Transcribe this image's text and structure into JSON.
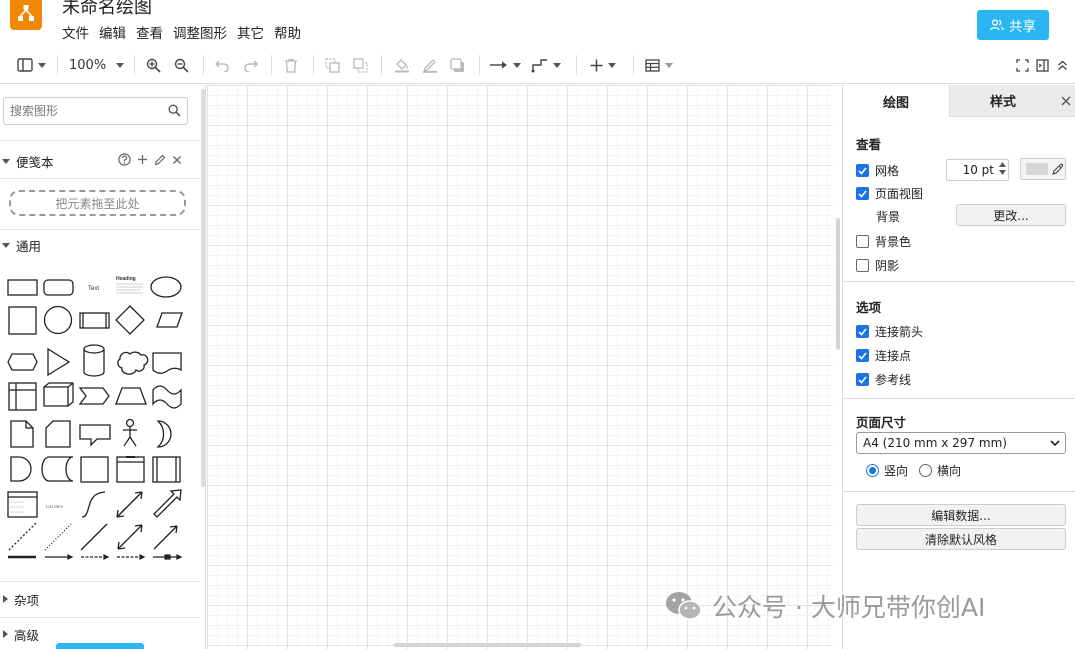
{
  "app": {
    "title": "未命名绘图",
    "brand_color": "#f08705",
    "accent_color": "#29b6f2",
    "logo_icon": "drawio-logo-icon"
  },
  "menu": [
    "文件",
    "编辑",
    "查看",
    "调整图形",
    "其它",
    "帮助"
  ],
  "share_button": {
    "label": "共享",
    "icon": "users-icon"
  },
  "toolbar": {
    "zoom": "100%",
    "icons": [
      "sidebar-toggle-icon",
      "zoom-in-icon",
      "zoom-out-icon",
      "undo-icon",
      "redo-icon",
      "delete-icon",
      "to-front-icon",
      "to-back-icon",
      "fill-color-icon",
      "line-color-icon",
      "shadow-icon",
      "connection-icon",
      "waypoints-icon",
      "insert-icon",
      "table-icon",
      "fullscreen-icon",
      "format-panel-icon",
      "collapse-icon"
    ]
  },
  "sidebar": {
    "search_placeholder": "搜索图形",
    "scratchpad": {
      "title": "便笺本",
      "dropzone": "把元素拖至此处"
    },
    "general": {
      "title": "通用"
    },
    "shape_labels": {
      "text": "Text",
      "heading": "Heading",
      "list": "List Item"
    },
    "misc": {
      "title": "杂项"
    },
    "advanced": {
      "title": "高级"
    }
  },
  "panel": {
    "tabs": [
      "绘图",
      "样式"
    ],
    "view": {
      "title": "查看",
      "grid": {
        "label": "网格",
        "checked": true
      },
      "grid_size": "10 pt",
      "page_view": {
        "label": "页面视图",
        "checked": true
      },
      "background": {
        "label": "背景",
        "button": "更改..."
      },
      "background_color": {
        "label": "背景色",
        "checked": false
      },
      "shadow": {
        "label": "阴影",
        "checked": false
      }
    },
    "options": {
      "title": "选项",
      "connection_arrows": {
        "label": "连接箭头",
        "checked": true
      },
      "connection_points": {
        "label": "连接点",
        "checked": true
      },
      "guides": {
        "label": "参考线",
        "checked": true
      }
    },
    "page_size": {
      "title": "页面尺寸",
      "selected": "A4 (210 mm x 297 mm)",
      "portrait": "竖向",
      "landscape": "横向",
      "orientation": "portrait"
    },
    "edit_data": "编辑数据...",
    "clear_style": "清除默认风格"
  },
  "watermark": "公众号 · 大师兄带你创AI"
}
